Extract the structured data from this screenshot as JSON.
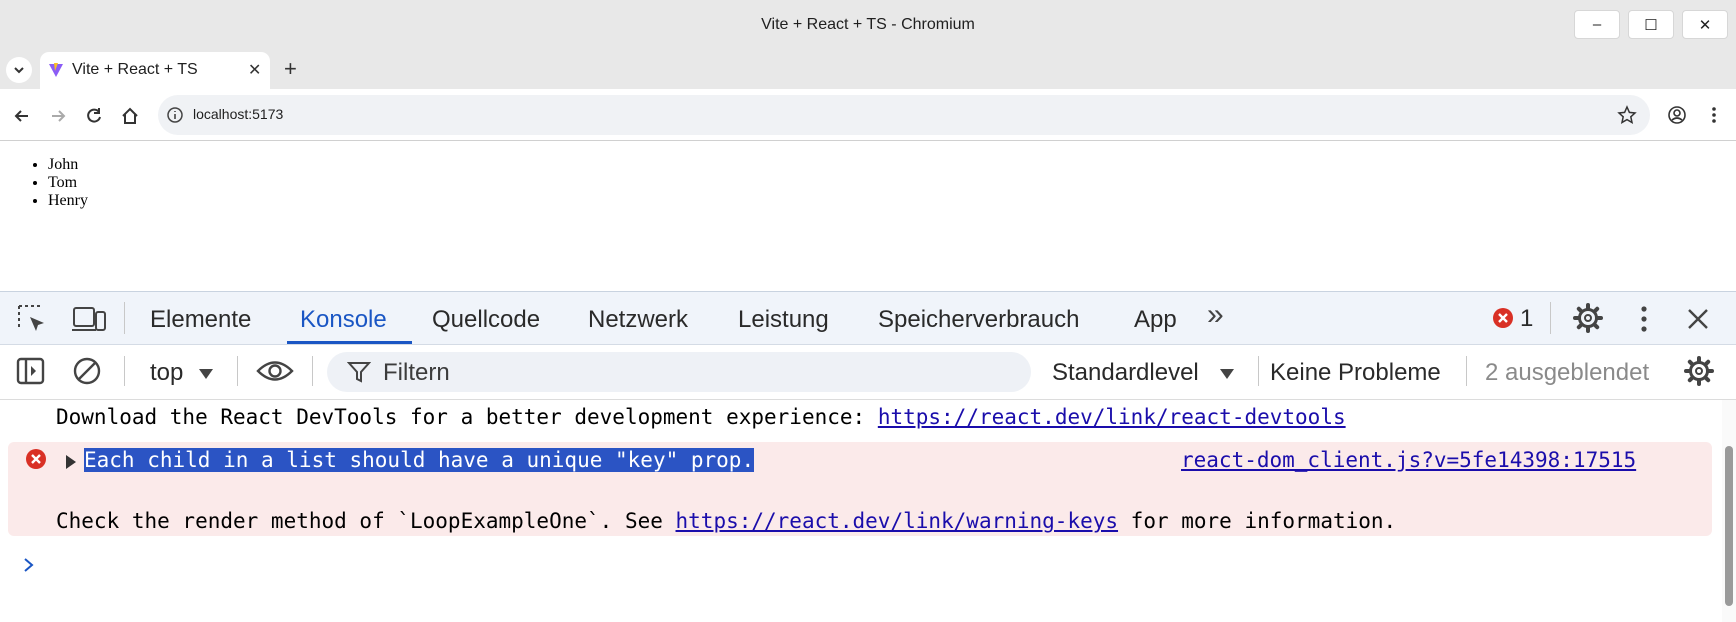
{
  "window": {
    "title": "Vite + React + TS - Chromium",
    "minimize_label": "–",
    "maximize_label": "☐",
    "close_label": "✕"
  },
  "tabs": {
    "active_title": "Vite + React + TS",
    "close_label": "✕",
    "new_tab_label": "+"
  },
  "toolbar": {
    "url": "localhost:5173"
  },
  "page": {
    "list_items": [
      "John",
      "Tom",
      "Henry"
    ]
  },
  "devtools": {
    "tabs": [
      "Elemente",
      "Konsole",
      "Quellcode",
      "Netzwerk",
      "Leistung",
      "Speicherverbrauch",
      "App"
    ],
    "more_tabs_label": "»",
    "error_count": "1",
    "console_bar": {
      "context": "top",
      "filter_placeholder": "Filtern",
      "level": "Standardlevel",
      "issues": "Keine Probleme",
      "hidden": "2 ausgeblendet"
    },
    "messages": {
      "info_text": "Download the React DevTools for a better development experience: ",
      "info_link": "https://react.dev/link/react-devtools",
      "error_title": "Each child in a list should have a unique \"key\" prop.",
      "error_source": "react-dom_client.js?v=5fe14398:17515",
      "error_detail_pre": "Check the render method of `LoopExampleOne`. See ",
      "error_detail_link": "https://react.dev/link/warning-keys",
      "error_detail_post": " for more information."
    }
  },
  "colors": {
    "accent": "#1a56c4",
    "error_bg": "#fbeaea",
    "error_icon": "#d93025",
    "link": "#1a0dab"
  }
}
